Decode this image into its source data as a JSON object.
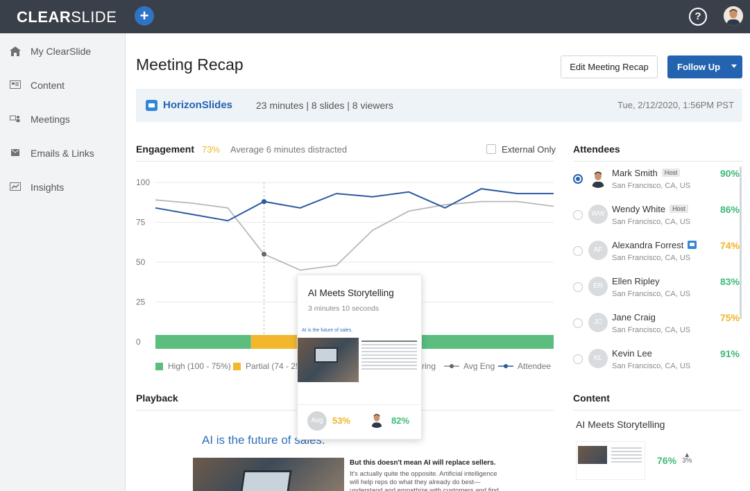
{
  "app": {
    "logo_bold": "CLEAR",
    "logo_light": "SLIDE",
    "add_icon": "plus-icon",
    "help_icon": "question-icon",
    "brand_color": "#2463b0"
  },
  "sidebar": {
    "items": [
      {
        "label": "My ClearSlide",
        "icon": "home-icon"
      },
      {
        "label": "Content",
        "icon": "content-icon"
      },
      {
        "label": "Meetings",
        "icon": "meetings-icon"
      },
      {
        "label": "Emails & Links",
        "icon": "email-icon"
      },
      {
        "label": "Insights",
        "icon": "insights-icon"
      }
    ]
  },
  "header": {
    "title": "Meeting Recap",
    "edit_label": "Edit Meeting Recap",
    "follow_label": "Follow Up"
  },
  "meeting": {
    "presentation": "HorizonSlides",
    "stats": "23 minutes | 8 slides | 8 viewers",
    "date": "Tue, 2/12/2020, 1:56PM PST"
  },
  "engagement": {
    "title": "Engagement",
    "percent": "73%",
    "subtitle": "Average 6 minutes distracted",
    "external_label": "External Only",
    "legend": {
      "high": "High (100 - 75%)",
      "partial": "Partial (74 - 25",
      "low_partial": "ring",
      "avg": "Avg Eng",
      "attendee": "Attendee"
    }
  },
  "chart_data": {
    "type": "line",
    "ylim": [
      0,
      100
    ],
    "yticks": [
      "100",
      "75",
      "50",
      "25",
      "0"
    ],
    "series": [
      {
        "name": "Avg Eng",
        "color": "#b8b8b8",
        "values": [
          89,
          87,
          84,
          55,
          45,
          48,
          70,
          82,
          86,
          88,
          88,
          85
        ]
      },
      {
        "name": "Attendee",
        "color": "#2a5aa0",
        "values": [
          84,
          80,
          76,
          88,
          84,
          93,
          91,
          94,
          84,
          96,
          93,
          93
        ]
      }
    ],
    "highlight_index": 3,
    "band": [
      {
        "level": "High",
        "color": "#5bbd7e",
        "from": 0.0,
        "to": 0.24
      },
      {
        "level": "Partial",
        "color": "#f2b72d",
        "from": 0.24,
        "to": 0.42
      },
      {
        "level": "High",
        "color": "#5bbd7e",
        "from": 0.42,
        "to": 1.0
      }
    ]
  },
  "attendees": {
    "title": "Attendees",
    "list": [
      {
        "name": "Mark Smith",
        "initials": "",
        "location": "San Francisco, CA, US",
        "percent": "90%",
        "badge": "Host",
        "color": "#3dbb7a",
        "selected": true
      },
      {
        "name": "Wendy White",
        "initials": "WW",
        "location": "San Francisco, CA, US",
        "percent": "86%",
        "badge": "Host",
        "color": "#3dbb7a",
        "selected": false
      },
      {
        "name": "Alexandra Forrest",
        "initials": "AF",
        "location": "San Francisco, CA, US",
        "percent": "74%",
        "badge": "",
        "color": "#f0b428",
        "selected": false
      },
      {
        "name": "Ellen Ripley",
        "initials": "ER",
        "location": "San Francisco, CA, US",
        "percent": "83%",
        "badge": "",
        "color": "#3dbb7a",
        "selected": false
      },
      {
        "name": "Jane Craig",
        "initials": "JC",
        "location": "San Francisco, CA, US",
        "percent": "75%",
        "badge": "",
        "color": "#f0b428",
        "selected": false
      },
      {
        "name": "Kevin Lee",
        "initials": "KL",
        "location": "San Francisco, CA, US",
        "percent": "91%",
        "badge": "",
        "color": "#3dbb7a",
        "selected": false
      }
    ]
  },
  "tooltip": {
    "title": "AI Meets Storytelling",
    "duration": "3 minutes 10 seconds",
    "slide_caption": "AI is the future of sales.",
    "avg_label": "Avg",
    "avg_percent": "53%",
    "attendee_percent": "82%"
  },
  "playback": {
    "title": "Playback",
    "slide_heading": "AI is the future of sales.",
    "slide_bold": "But this doesn't mean AI will replace sellers.",
    "slide_text": "It's actually quite the opposite. Artificial intelligence will help reps do what they already do best—understand and empathize with customers and find solutions."
  },
  "content": {
    "title": "Content",
    "item_name": "AI Meets Storytelling",
    "item_percent": "76%",
    "item_delta": "3%"
  }
}
